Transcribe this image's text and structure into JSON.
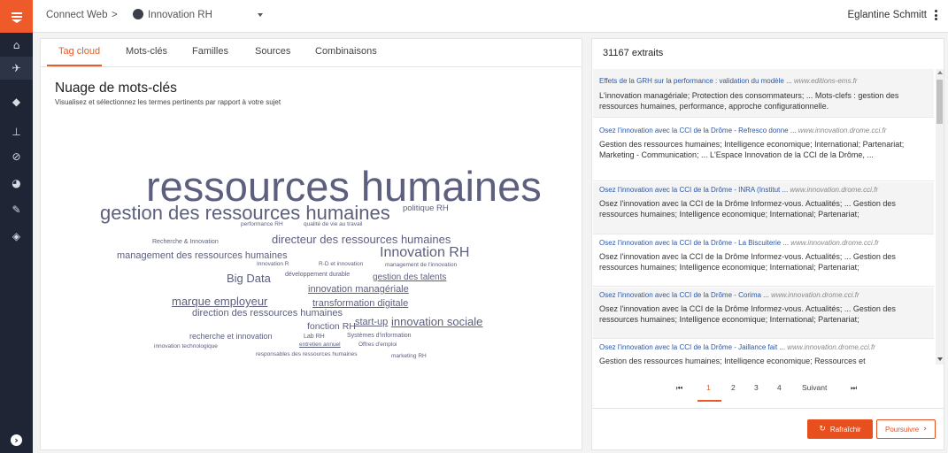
{
  "topbar": {
    "breadcrumb_root": "Connect Web",
    "breadcrumb_sep": ">",
    "breadcrumb_current": "Innovation RH",
    "user_name": "Eglantine Schmitt"
  },
  "sidebar": {
    "items": [
      {
        "name": "home-icon",
        "glyph": "⌂"
      },
      {
        "name": "rocket-icon",
        "glyph": "✈"
      },
      {
        "name": "tags-icon",
        "glyph": "◆"
      },
      {
        "name": "sitemap-icon",
        "glyph": "⊥"
      },
      {
        "name": "compass-icon",
        "glyph": "⊘"
      },
      {
        "name": "pie-chart-icon",
        "glyph": "◕"
      },
      {
        "name": "wrench-icon",
        "glyph": "✎"
      },
      {
        "name": "diamond-icon",
        "glyph": "◈"
      },
      {
        "name": "expand-icon",
        "glyph": "›"
      }
    ]
  },
  "tabs": [
    {
      "label": "Tag cloud",
      "active": true
    },
    {
      "label": "Mots-clés",
      "active": false
    },
    {
      "label": "Familles",
      "active": false
    },
    {
      "label": "Sources",
      "active": false
    },
    {
      "label": "Combinaisons",
      "active": false
    }
  ],
  "cloud": {
    "title": "Nuage de mots-clés",
    "subtitle": "Visualisez et sélectionnez les termes pertinents par rapport à votre sujet",
    "words": [
      {
        "text": "ressources humaines",
        "weight": 100,
        "underline": false
      },
      {
        "text": "gestion des ressources humaines",
        "weight": 55,
        "underline": false
      },
      {
        "text": "politique RH",
        "weight": 20,
        "underline": false
      },
      {
        "text": "performance RH",
        "weight": 12,
        "underline": false
      },
      {
        "text": "qualité de vie au travail",
        "weight": 12,
        "underline": false
      },
      {
        "text": "Recherche & Innovation",
        "weight": 12,
        "underline": false
      },
      {
        "text": "directeur des ressources humaines",
        "weight": 32,
        "underline": false
      },
      {
        "text": "Innovation RH",
        "weight": 38,
        "underline": false
      },
      {
        "text": "management des ressources humaines",
        "weight": 25,
        "underline": false
      },
      {
        "text": "Innovation R",
        "weight": 11,
        "underline": false
      },
      {
        "text": "R-D et innovation",
        "weight": 11,
        "underline": false
      },
      {
        "text": "management de l'innovation",
        "weight": 11,
        "underline": false
      },
      {
        "text": "Big Data",
        "weight": 30,
        "underline": false
      },
      {
        "text": "développement durable",
        "weight": 11,
        "underline": false
      },
      {
        "text": "gestion des talents",
        "weight": 22,
        "underline": true
      },
      {
        "text": "innovation managériale",
        "weight": 24,
        "underline": true
      },
      {
        "text": "marque employeur",
        "weight": 30,
        "underline": true
      },
      {
        "text": "transformation digitale",
        "weight": 24,
        "underline": true
      },
      {
        "text": "direction des ressources humaines",
        "weight": 27,
        "underline": false
      },
      {
        "text": "fonction RH",
        "weight": 24,
        "underline": false
      },
      {
        "text": "start-up",
        "weight": 24,
        "underline": true
      },
      {
        "text": "innovation sociale",
        "weight": 30,
        "underline": true
      },
      {
        "text": "recherche et innovation",
        "weight": 18,
        "underline": false
      },
      {
        "text": "Lab RH",
        "weight": 13,
        "underline": false
      },
      {
        "text": "Systèmes d'information",
        "weight": 13,
        "underline": false
      },
      {
        "text": "innovation technologique",
        "weight": 12,
        "underline": false
      },
      {
        "text": "entretien annuel",
        "weight": 12,
        "underline": true
      },
      {
        "text": "Offres d'emploi",
        "weight": 12,
        "underline": false
      },
      {
        "text": "responsables des ressources humaines",
        "weight": 12,
        "underline": false
      },
      {
        "text": "marketing RH",
        "weight": 12,
        "underline": false
      }
    ]
  },
  "results": {
    "count_label": "31167 extraits",
    "items": [
      {
        "title": "Effets de la GRH sur la performance : validation du modèle ...",
        "url": "www.editions-ems.fr",
        "body": "L'innovation managériale; Protection des consommateurs; ... Mots-clefs : gestion des ressources humaines, performance, approche configurationnelle."
      },
      {
        "title": "Osez l'innovation avec la CCI de la Drôme - Refresco donne ...",
        "url": "www.innovation.drome.cci.fr",
        "body": "Gestion des ressources humaines; Intelligence economique; International; Partenariat; Marketing - Communication; ... L'Espace Innovation de la CCI de la Drôme, ..."
      },
      {
        "title": "Osez l'innovation avec la CCI de la Drôme - INRA (Institut ...",
        "url": "www.innovation.drome.cci.fr",
        "body": "Osez l'innovation avec la CCI de la Drôme Informez-vous. Actualités; ... Gestion des ressources humaines; Intelligence economique; International; Partenariat;"
      },
      {
        "title": "Osez l'innovation avec la CCI de la Drôme - La Biscuiterie ...",
        "url": "www.innovation.drome.cci.fr",
        "body": "Osez l'innovation avec la CCI de la Drôme Informez-vous. Actualités; ... Gestion des ressources humaines; Intelligence economique; International; Partenariat;"
      },
      {
        "title": "Osez l'innovation avec la CCI de la Drôme - Corima ...",
        "url": "www.innovation.drome.cci.fr",
        "body": "Osez l'innovation avec la CCI de la Drôme Informez-vous. Actualités; ... Gestion des ressources humaines; Intelligence economique; International; Partenariat;"
      },
      {
        "title": "Osez l'innovation avec la CCI de la Drôme - Jaillance fait ...",
        "url": "www.innovation.drome.cci.fr",
        "body": "Gestion des ressources humaines; Intelligence economique; Ressources et"
      }
    ]
  },
  "pagination": {
    "first_icon": "first-page-icon",
    "pages": [
      "1",
      "2",
      "3",
      "4"
    ],
    "active_page": "1",
    "next_label": "Suivant",
    "last_icon": "last-page-icon"
  },
  "actions": {
    "refresh_label": "Rafraîchir",
    "continue_label": "Poursuivre"
  },
  "colors": {
    "accent": "#e85a2a",
    "sidebar_bg": "#1f2535",
    "cloud_word": "#5c5f7d",
    "link": "#2a57a6"
  }
}
